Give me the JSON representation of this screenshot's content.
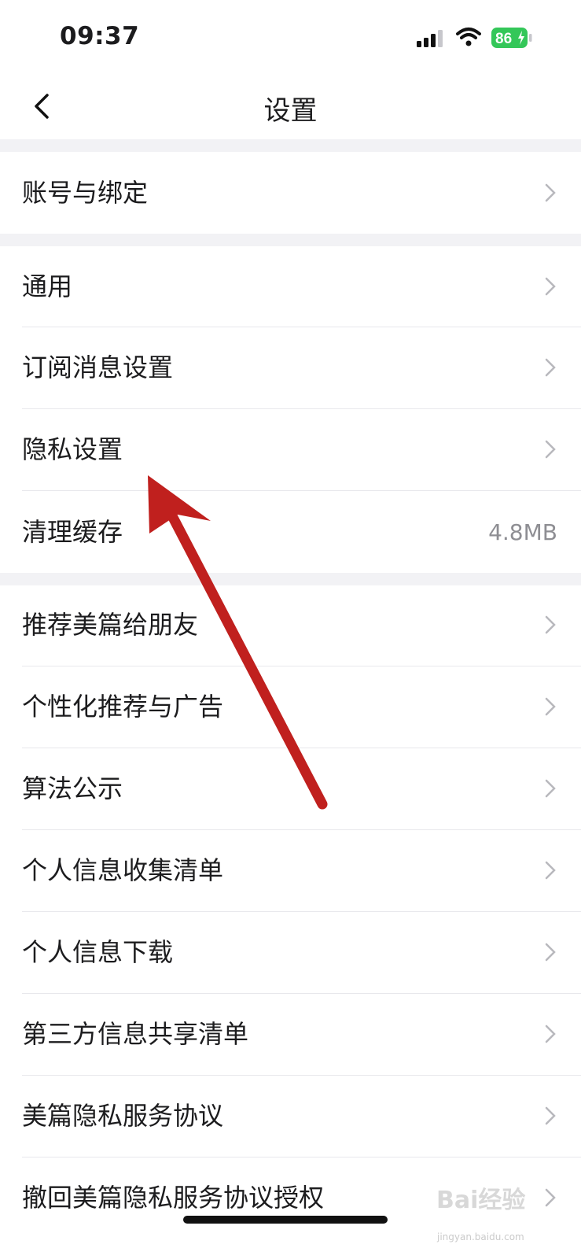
{
  "status_bar": {
    "time": "09:37",
    "battery": "86"
  },
  "nav": {
    "title": "设置",
    "back_icon": "chevron-left-icon"
  },
  "sections": [
    {
      "items": [
        {
          "label": "账号与绑定"
        }
      ]
    },
    {
      "items": [
        {
          "label": "通用"
        },
        {
          "label": "订阅消息设置"
        },
        {
          "label": "隐私设置"
        },
        {
          "label": "清理缓存",
          "value": "4.8MB"
        }
      ]
    },
    {
      "items": [
        {
          "label": "推荐美篇给朋友"
        },
        {
          "label": "个性化推荐与广告"
        },
        {
          "label": "算法公示"
        },
        {
          "label": "个人信息收集清单"
        },
        {
          "label": "个人信息下载"
        },
        {
          "label": "第三方信息共享清单"
        },
        {
          "label": "美篇隐私服务协议"
        },
        {
          "label": "撤回美篇隐私服务协议授权"
        }
      ]
    }
  ],
  "watermark": {
    "text": "Bai经验",
    "sub": "jingyan.baidu.com"
  },
  "colors": {
    "background_gap": "#f2f2f5",
    "annotation_arrow": "#c0201e",
    "battery_green": "#34c759"
  }
}
